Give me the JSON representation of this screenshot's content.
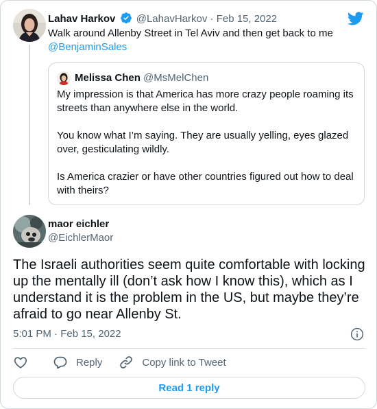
{
  "parent_tweet": {
    "name": "Lahav Harkov",
    "handle": "@LahavHarkov",
    "separator": "·",
    "date": "Feb 15, 2022",
    "text": "Walk around Allenby Street in Tel Aviv and then get back to me",
    "mention": "@BenjaminSales"
  },
  "quoted_tweet": {
    "name": "Melissa Chen",
    "handle": "@MsMelChen",
    "paragraphs": [
      "My impression is that America has more crazy people roaming its streets than anywhere else in the world.",
      "You know what I’m saying. They are usually yelling, eyes glazed over, gesticulating wildly.",
      "Is America crazier or have other countries figured out how to deal with theirs?"
    ]
  },
  "main_tweet": {
    "name": "maor eichler",
    "handle": "@EichlerMaor",
    "text": "The Israeli authorities seem quite comfortable with locking up the mentally ill (don’t ask how I know this), which as I understand it is the problem in the US, but maybe they’re afraid to go near Allenby St.",
    "timestamp": "5:01 PM · Feb 15, 2022"
  },
  "actions": {
    "reply": "Reply",
    "copy_link": "Copy link to Tweet",
    "read_replies": "Read 1 reply"
  },
  "colors": {
    "accent": "#1d9bf0",
    "like_icon": "#536471",
    "text": "#0f1419",
    "muted": "#536471",
    "border": "#cfd9de"
  },
  "icons": {
    "brand": "twitter-bird-icon",
    "verified": "verified-badge-icon",
    "info": "info-icon",
    "like": "heart-icon",
    "reply": "speech-bubble-icon",
    "copy": "link-icon"
  }
}
